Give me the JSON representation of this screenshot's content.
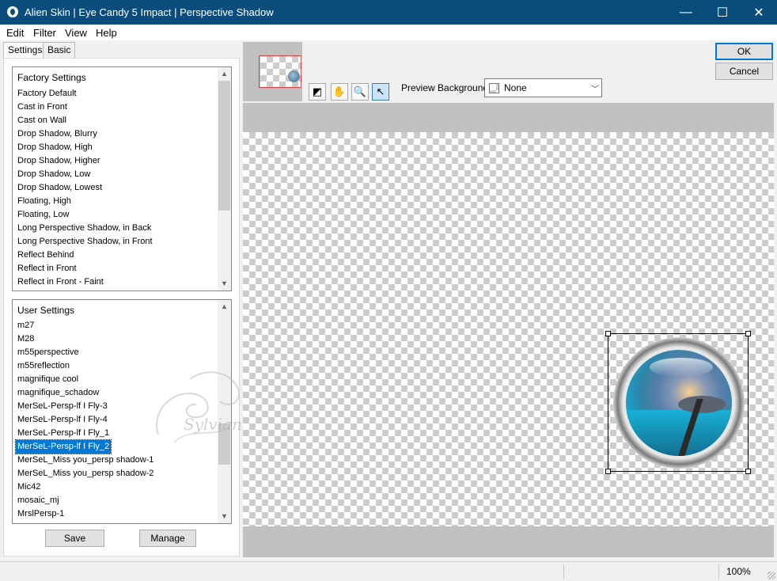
{
  "window": {
    "title": "Alien Skin | Eye Candy 5 Impact | Perspective Shadow",
    "minimize_glyph": "—",
    "maximize_glyph": "☐",
    "close_glyph": "✕"
  },
  "menu": [
    "Edit",
    "Filter",
    "View",
    "Help"
  ],
  "tabs": {
    "settings": "Settings",
    "basic": "Basic"
  },
  "factory": {
    "header": "Factory Settings",
    "items": [
      "Factory Default",
      "Cast in Front",
      "Cast on Wall",
      "Drop Shadow, Blurry",
      "Drop Shadow, High",
      "Drop Shadow, Higher",
      "Drop Shadow, Low",
      "Drop Shadow, Lowest",
      "Floating, High",
      "Floating, Low",
      "Long Perspective Shadow, in Back",
      "Long Perspective Shadow, in Front",
      "Reflect Behind",
      "Reflect in Front",
      "Reflect in Front - Faint"
    ]
  },
  "user": {
    "header": "User Settings",
    "items": [
      "m27",
      "M28",
      "m55perspective",
      "m55reflection",
      "magnifique cool",
      "magnifique_schadow",
      "MerSeL-Persp-lf I Fly-3",
      "MerSeL-Persp-lf I Fly-4",
      "MerSeL-Persp-lf I Fly_1",
      "MerSeL-Persp-lf I Fly_2",
      "MerSeL_Miss you_persp shadow-1",
      "MerSeL_Miss you_persp shadow-2",
      "Mic42",
      "mosaic_mj",
      "MrslPersp-1"
    ],
    "selected_index": 9
  },
  "buttons": {
    "save": "Save",
    "manage": "Manage",
    "ok": "OK",
    "cancel": "Cancel"
  },
  "toolbar": {
    "tools": [
      {
        "name": "preview-toggle-icon",
        "glyph": "◩"
      },
      {
        "name": "hand-icon",
        "glyph": "✋"
      },
      {
        "name": "zoom-icon",
        "glyph": "🔍"
      },
      {
        "name": "pointer-icon",
        "glyph": "↖"
      }
    ],
    "active_tool": "pointer-icon"
  },
  "preview_background": {
    "label": "Preview Background:",
    "value": "None"
  },
  "status": {
    "zoom": "100%"
  },
  "watermark": {
    "text": "Sylviane"
  },
  "colors": {
    "titlebar": "#0a4d7d",
    "selection": "#0078d7",
    "preview_frame": "#c0c0c0"
  }
}
